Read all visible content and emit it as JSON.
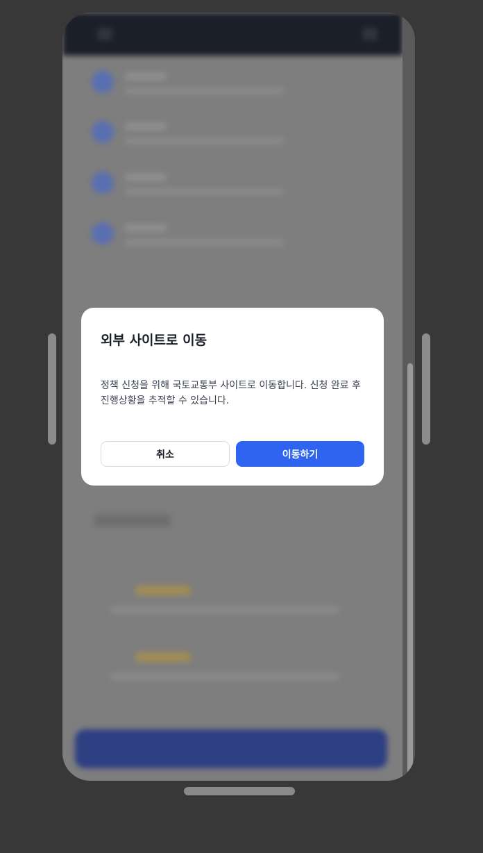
{
  "dialog": {
    "title": "외부 사이트로 이동",
    "message": "정책 신청을 위해 국토교통부 사이트로 이동합니다. 신청 완료 후 진행상황을 추적할 수 있습니다.",
    "cancel_label": "취소",
    "confirm_label": "이동하기"
  },
  "colors": {
    "accent": "#2f64f0",
    "overlay": "#7e7e7e",
    "device_bg": "#383838"
  }
}
